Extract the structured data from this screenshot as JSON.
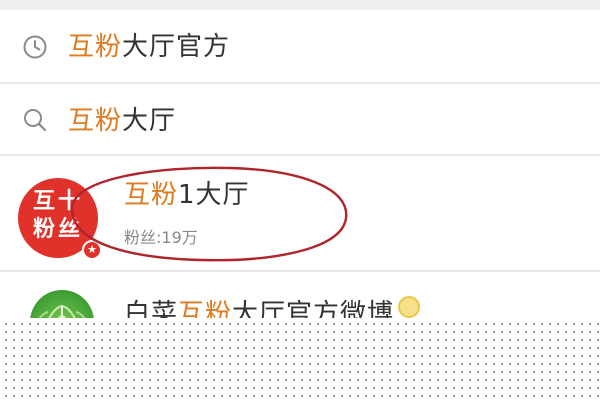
{
  "history": {
    "icon": "clock-icon",
    "highlight": "互粉",
    "rest": "大厅官方"
  },
  "suggestion": {
    "icon": "search-icon",
    "highlight": "互粉",
    "rest": "大厅"
  },
  "account_top": {
    "avatar_line1": "互十",
    "avatar_line2": "粉丝",
    "name_highlight": "互粉",
    "name_rest": "1大厅",
    "meta": "粉丝:19万",
    "circle_color": "#b0242c"
  },
  "account_second": {
    "name_prefix": "白菜",
    "name_highlight": "互粉",
    "name_rest": "大厅官方微博"
  },
  "colors": {
    "highlight": "#e07a1e",
    "avatar": "#e0322a",
    "divider": "#e8e8e8"
  }
}
